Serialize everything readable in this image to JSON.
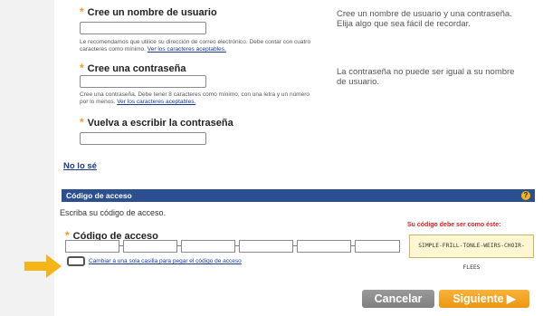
{
  "username": {
    "label": "Cree un nombre de usuario",
    "help": "Le recomendamos que utilice su dirección de correo electrónico. Debe contar con cuatro caracteres como mínimo.",
    "help_link": "Ver los caracteres aceptables.",
    "side_text": "Cree un nombre de usuario y una contraseña. Elija algo que sea fácil de recordar."
  },
  "password": {
    "label": "Cree una contraseña",
    "help": "Cree una contraseña. Debe tener 8 caracteres como mínimo, con una letra y un número por lo menos.",
    "help_link": "Ver los caracteres aceptables.",
    "side_text": "La contraseña no puede ser igual a su nombre de usuario."
  },
  "confirm": {
    "label": "Vuelva a escribir la contraseña"
  },
  "dont_know_link": "No lo sé",
  "access_code": {
    "bar_title": "Código de acceso",
    "help_badge": "?",
    "instruction": "Escriba su código de acceso.",
    "field_label": "Código de acceso",
    "sample_title": "Su código debe ser como éste:",
    "sample_code": "SIMPLE-FRILL-TONLE-WEIRS-CHOIR-FLEES",
    "single_box_link": "Cambiar a una sola casilla para pegar el código de acceso"
  },
  "buttons": {
    "cancel": "Cancelar",
    "next": "Siguiente ▶"
  },
  "colors": {
    "accent": "#f39a1c",
    "bar": "#2c4f91",
    "link": "#1a3a8f",
    "arrow": "#f5b417"
  },
  "icons": {
    "arrow": "arrow-right-icon"
  }
}
